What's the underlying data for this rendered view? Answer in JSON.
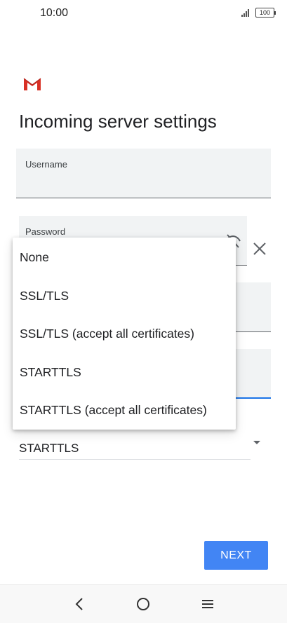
{
  "status_bar": {
    "time": "10:00",
    "battery": "100"
  },
  "icons": {
    "logo": "gmail-logo",
    "password_toggle": "visibility-off-icon",
    "clear": "close-icon",
    "dropdown_arrow": "arrow-drop-down-icon",
    "nav_back": "back-icon",
    "nav_home": "home-icon",
    "nav_menu": "menu-icon"
  },
  "page": {
    "title": "Incoming server settings"
  },
  "form": {
    "username_label": "Username",
    "password_label": "Password",
    "security_value": "STARTTLS"
  },
  "dropdown": {
    "options": [
      "None",
      "SSL/TLS",
      "SSL/TLS (accept all certificates)",
      "STARTTLS",
      "STARTTLS (accept all certificates)"
    ]
  },
  "actions": {
    "next_label": "NEXT"
  },
  "colors": {
    "accent": "#4285f4",
    "focus_underline": "#1a73e8",
    "field_background": "#f1f3f4"
  }
}
